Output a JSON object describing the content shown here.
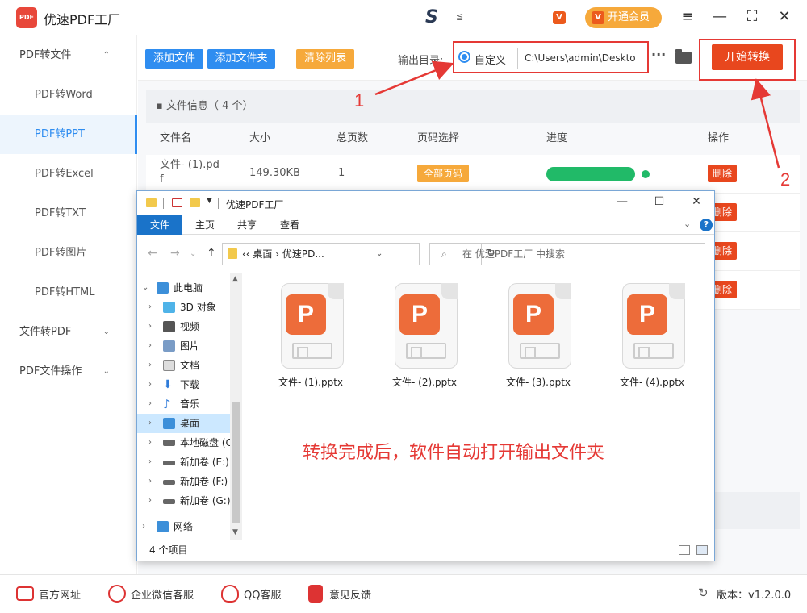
{
  "app": {
    "title": "优速PDF工厂",
    "logo_text": "PDF",
    "center_logo": "S",
    "center_logo_sub": "≦",
    "vip_label": "开通会员",
    "vip_mini": "V",
    "win_menu": "≡",
    "win_min": "—",
    "win_max": "⛶",
    "win_close": "✕"
  },
  "sidebar": {
    "items": [
      {
        "label": "PDF转文件",
        "type": "group",
        "chevron": "⌃"
      },
      {
        "label": "PDF转Word",
        "type": "sub"
      },
      {
        "label": "PDF转PPT",
        "type": "sub",
        "active": true
      },
      {
        "label": "PDF转Excel",
        "type": "sub"
      },
      {
        "label": "PDF转TXT",
        "type": "sub"
      },
      {
        "label": "PDF转图片",
        "type": "sub"
      },
      {
        "label": "PDF转HTML",
        "type": "sub"
      },
      {
        "label": "文件转PDF",
        "type": "group",
        "chevron": "⌄"
      },
      {
        "label": "PDF文件操作",
        "type": "group",
        "chevron": "⌄"
      }
    ]
  },
  "toolbar": {
    "add_file": "添加文件",
    "add_folder": "添加文件夹",
    "clear_list": "清除列表",
    "output_label": "输出目录:",
    "custom_label": "自定义",
    "path_value": "C:\\Users\\admin\\Deskto",
    "more": "···",
    "start": "开始转换"
  },
  "file_list": {
    "info_title": "文件信息（ 4 个）",
    "headers": {
      "name": "文件名",
      "size": "大小",
      "pages": "总页数",
      "page_select": "页码选择",
      "progress": "进度",
      "action": "操作"
    },
    "rows": [
      {
        "name": "文件- (1).pd",
        "name2": "f",
        "size": "149.30KB",
        "pages": "1",
        "page_select": "全部页码",
        "progress": 1.0,
        "action": "删除"
      },
      {
        "action": "删除"
      },
      {
        "action": "删除"
      },
      {
        "action": "删除"
      }
    ]
  },
  "annotations": {
    "num1": "1",
    "num2": "2",
    "note": "转换完成后，软件自动打开输出文件夹"
  },
  "explorer": {
    "title": "优速PDF工厂",
    "tabs": [
      "文件",
      "主页",
      "共享",
      "查看"
    ],
    "address": "‹‹  桌面  ›  优速PD...",
    "search_placeholder": "在 优速PDF工厂 中搜索",
    "tree": [
      {
        "label": "此电脑",
        "arrow": "⌄",
        "color": "#3c8fd9"
      },
      {
        "label": "3D 对象",
        "arrow": "›",
        "color": "#4fb3e8"
      },
      {
        "label": "视频",
        "arrow": "›",
        "color": "#555555"
      },
      {
        "label": "图片",
        "arrow": "›",
        "color": "#7a9cc6"
      },
      {
        "label": "文档",
        "arrow": "›",
        "color": "#8a8a8a"
      },
      {
        "label": "下载",
        "arrow": "›",
        "color": "#2f7bd9"
      },
      {
        "label": "音乐",
        "arrow": "›",
        "color": "#2f7bd9"
      },
      {
        "label": "桌面",
        "arrow": "›",
        "color": "#3c8fd9",
        "selected": true
      },
      {
        "label": "本地磁盘 (C:",
        "arrow": "›",
        "color": "#666666"
      },
      {
        "label": "新加卷 (E:)",
        "arrow": "›",
        "color": "#666666"
      },
      {
        "label": "新加卷 (F:)",
        "arrow": "›",
        "color": "#666666"
      },
      {
        "label": "新加卷 (G:)",
        "arrow": "›",
        "color": "#666666"
      },
      {
        "label": "网络",
        "arrow": "›",
        "color": "#3c8fd9"
      }
    ],
    "files": [
      {
        "name": "文件- (1).pptx",
        "badge": "P"
      },
      {
        "name": "文件- (2).pptx",
        "badge": "P"
      },
      {
        "name": "文件- (3).pptx",
        "badge": "P"
      },
      {
        "name": "文件- (4).pptx",
        "badge": "P"
      }
    ],
    "status": "4 个项目",
    "help": "?"
  },
  "footer": {
    "website": "官方网址",
    "wechat": "企业微信客服",
    "qq": "QQ客服",
    "feedback": "意见反馈",
    "version": "版本：v1.2.0.0"
  }
}
